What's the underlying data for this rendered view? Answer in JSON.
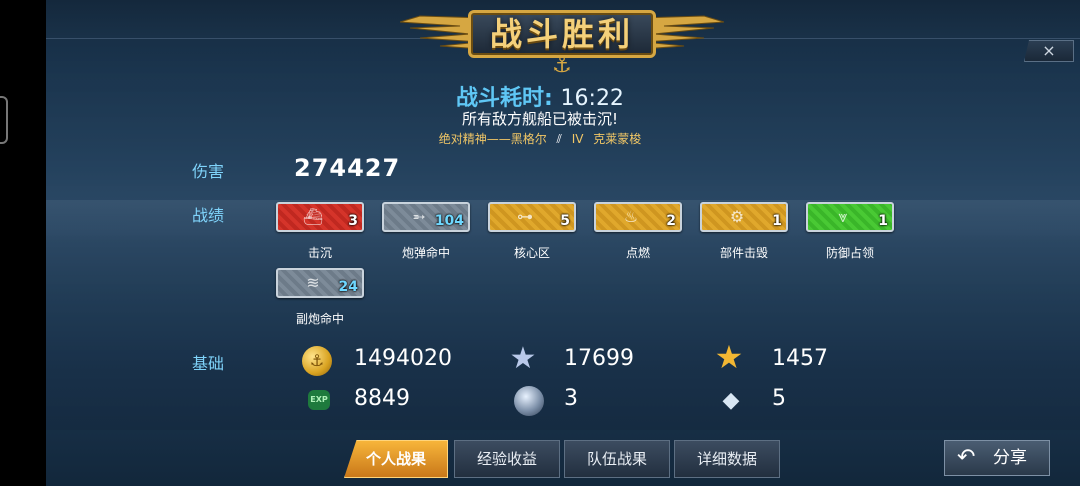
{
  "header": {
    "title": "战斗胜利",
    "close_glyph": "×",
    "battle_time_label": "战斗耗时:",
    "battle_time_value": "16:22",
    "result_message": "所有敌方舰船已被击沉!",
    "ship_left": "绝对精神——黑格尔",
    "ship_tier": "IV",
    "ship_right": "克莱蒙梭"
  },
  "damage": {
    "label": "伤害",
    "value": "274427"
  },
  "achievements": {
    "label": "战绩",
    "items": [
      {
        "name": "击沉",
        "count": "3",
        "icon": "ship-sunk-icon",
        "color": "#d5342a"
      },
      {
        "name": "炮弹命中",
        "count": "104",
        "icon": "shell-icon",
        "color": "#7d8b99"
      },
      {
        "name": "核心区",
        "count": "5",
        "icon": "citadel-icon",
        "color": "#e0a82c"
      },
      {
        "name": "点燃",
        "count": "2",
        "icon": "fire-icon",
        "color": "#e0a82c"
      },
      {
        "name": "部件击毁",
        "count": "1",
        "icon": "gear-icon",
        "color": "#e0a82c"
      },
      {
        "name": "防御占领",
        "count": "1",
        "icon": "defense-icon",
        "color": "#49c934"
      },
      {
        "name": "副炮命中",
        "count": "24",
        "icon": "secondary-gun-icon",
        "color": "#7d8b99"
      }
    ]
  },
  "base": {
    "label": "基础",
    "resources": [
      {
        "icon": "gold-coin-icon",
        "value": "1494020"
      },
      {
        "icon": "blue-star-icon",
        "value": "17699"
      },
      {
        "icon": "gold-star-icon",
        "value": "1457"
      },
      {
        "icon": "exp-icon",
        "icon_text": "EXP",
        "value": "8849"
      },
      {
        "icon": "silver-orb-icon",
        "value": "3"
      },
      {
        "icon": "diamond-icon",
        "value": "5"
      }
    ]
  },
  "tabs": [
    {
      "label": "个人战果",
      "active": true
    },
    {
      "label": "经验收益",
      "active": false
    },
    {
      "label": "队伍战果",
      "active": false
    },
    {
      "label": "详细数据",
      "active": false
    }
  ],
  "share": {
    "label": "分享"
  }
}
